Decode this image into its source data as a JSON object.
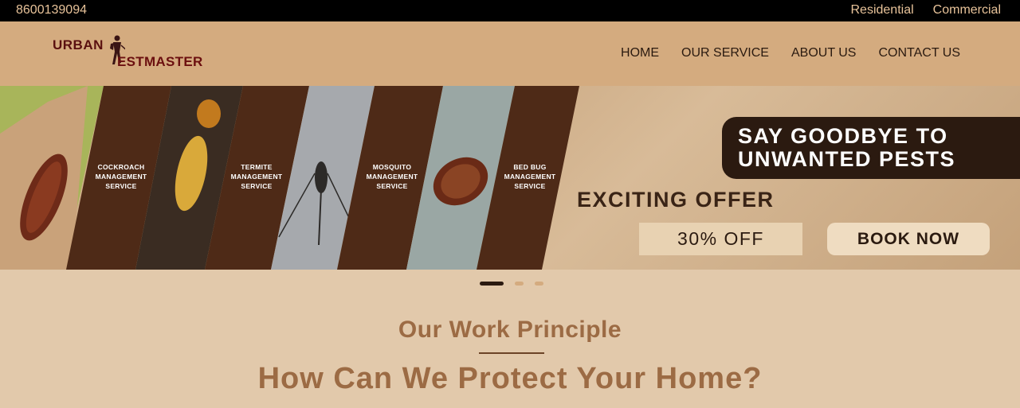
{
  "topbar": {
    "phone": "8600139094",
    "links": [
      "Residential",
      "Commercial"
    ]
  },
  "header": {
    "logo_line1": "URBAN",
    "logo_line2": "ESTMASTER",
    "nav": [
      "HOME",
      "OUR SERVICE",
      "ABOUT US",
      "CONTACT US"
    ]
  },
  "banner": {
    "panels": [
      {
        "label": "COCKROACH\nMANAGEMENT\nSERVICE",
        "icon": "cockroach-image"
      },
      {
        "label": "TERMITE\nMANAGEMENT\nSERVICE",
        "icon": "termite-image"
      },
      {
        "label": "MOSQUITO\nMANAGEMENT\nSERVICE",
        "icon": "mosquito-image"
      },
      {
        "label": "BED BUG\nMANAGEMENT\nSERVICE",
        "icon": "bedbug-image"
      }
    ],
    "headline_line1": "SAY GOODBYE TO",
    "headline_line2": "UNWANTED PESTS",
    "offer_title": "EXCITING OFFER",
    "offer_value": "30% OFF",
    "cta": "BOOK NOW"
  },
  "slider": {
    "count": 3,
    "active": 1
  },
  "section": {
    "subtitle": "Our Work Principle",
    "title": "How Can We Protect Your Home?"
  },
  "colors": {
    "topbar_bg": "#000000",
    "header_bg": "#d4ab7f",
    "accent_dark": "#2b1a10",
    "heading": "#9c6b44",
    "page_bg": "#e2c9ab"
  }
}
